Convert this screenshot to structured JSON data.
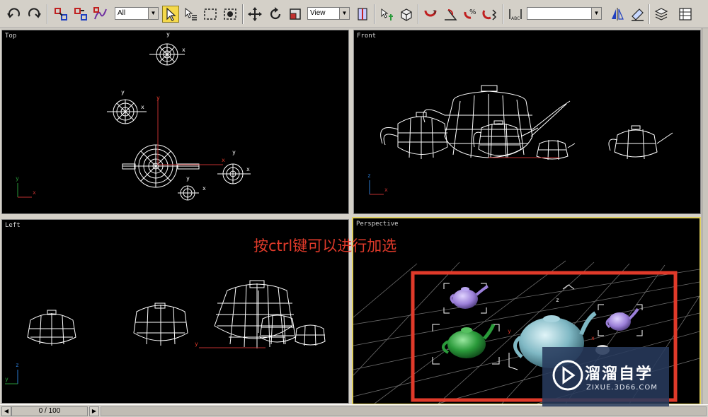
{
  "toolbar": {
    "selection_filter": "All",
    "reference_coord": "View",
    "named_selection": "",
    "icons": [
      "undo-icon",
      "redo-icon",
      "link-icon",
      "unlink-icon",
      "bind-space-warp-icon",
      "select-object-icon",
      "select-by-name-icon",
      "rectangular-selection-icon",
      "window-crossing-icon",
      "move-icon",
      "rotate-icon",
      "scale-icon",
      "use-pivot-icon",
      "select-manipulate-icon",
      "keyboard-shortcut-icon",
      "snaps-toggle-icon",
      "angle-snap-icon",
      "percent-snap-icon",
      "spinner-snap-icon",
      "edit-named-selection-icon",
      "mirror-icon",
      "align-icon",
      "layer-manager-icon",
      "curve-editor-icon"
    ]
  },
  "viewports": {
    "top": {
      "label": "Top"
    },
    "front": {
      "label": "Front"
    },
    "left": {
      "label": "Left"
    },
    "perspective": {
      "label": "Perspective"
    }
  },
  "axes": {
    "x": "x",
    "y": "y",
    "z": "z"
  },
  "annotation": {
    "text": "按ctrl键可以进行加选",
    "color": "#e03a2a"
  },
  "selection_box_color": "#e03a2a",
  "time_slider": {
    "value": "0 / 100"
  },
  "watermark": {
    "title": "溜溜自学",
    "subtitle": "ZIXUE.3D66.COM"
  },
  "colors": {
    "viewport_bg": "#000000",
    "active_border": "#e0d060",
    "wireframe": "#ffffff",
    "teapot_purple": "#9b7fd8",
    "teapot_green": "#2a9a3a",
    "teapot_cyan": "#7fb8c4"
  }
}
